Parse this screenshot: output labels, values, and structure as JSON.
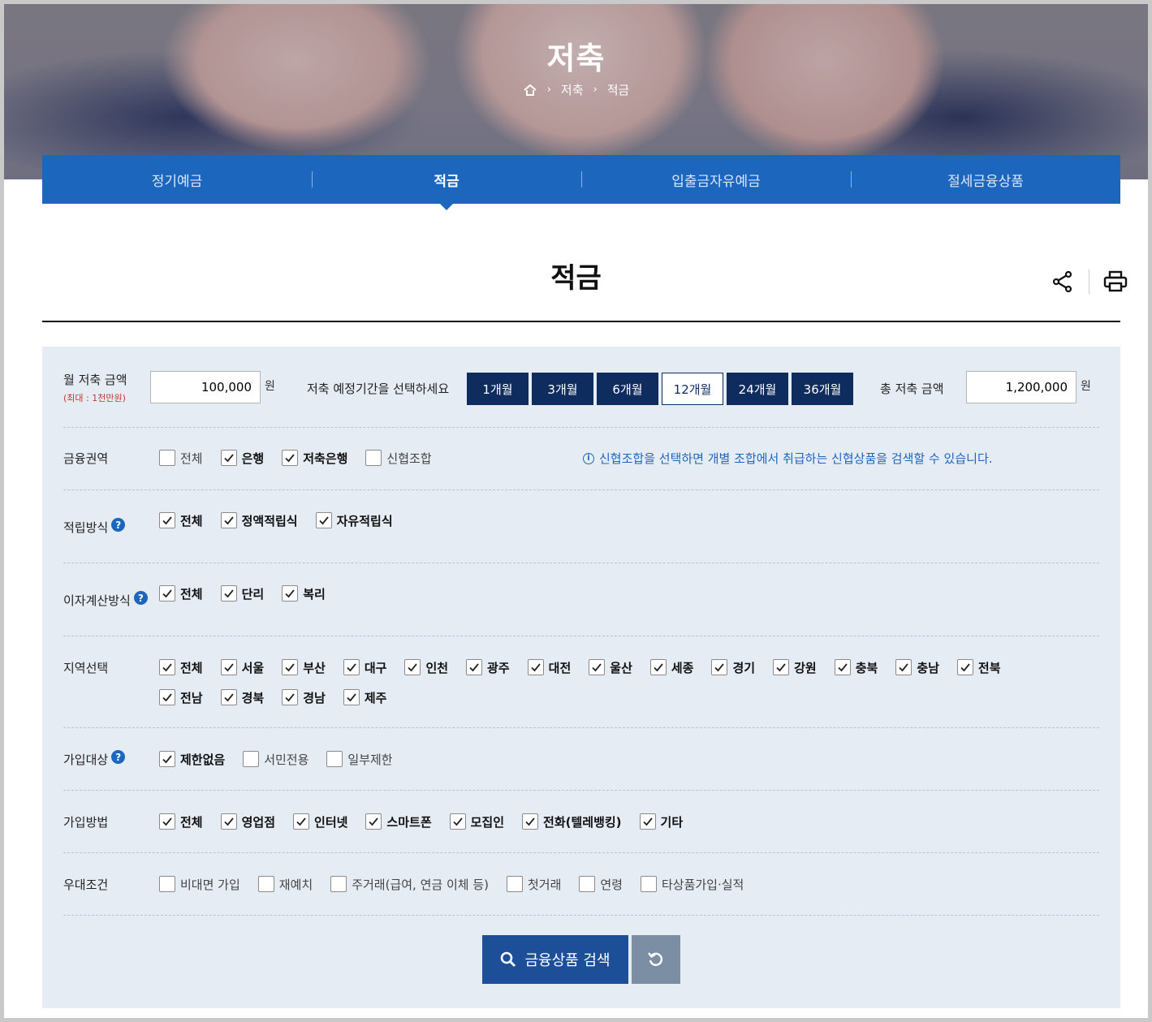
{
  "hero": {
    "title": "저축",
    "breadcrumb": [
      "저축",
      "적금"
    ]
  },
  "tabs": [
    {
      "label": "정기예금",
      "active": false
    },
    {
      "label": "적금",
      "active": true
    },
    {
      "label": "입출금자유예금",
      "active": false
    },
    {
      "label": "절세금융상품",
      "active": false
    }
  ],
  "page": {
    "title": "적금"
  },
  "calc": {
    "monthly_label": "월 저축 금액",
    "monthly_sub": "(최대 : 1천만원)",
    "monthly_value": "100,000",
    "unit": "원",
    "period_label": "저축 예정기간을 선택하세요",
    "periods": [
      "1개월",
      "3개월",
      "6개월",
      "12개월",
      "24개월",
      "36개월"
    ],
    "selected_period": "12개월",
    "total_label": "총 저축 금액",
    "total_value": "1,200,000"
  },
  "filters": {
    "region": {
      "label": "금융권역",
      "options": [
        {
          "label": "전체",
          "checked": false
        },
        {
          "label": "은행",
          "checked": true
        },
        {
          "label": "저축은행",
          "checked": true
        },
        {
          "label": "신협조합",
          "checked": false
        }
      ],
      "note": "신협조합을 선택하면 개별 조합에서 취급하는 신협상품을 검색할 수 있습니다."
    },
    "saving_method": {
      "label": "적립방식",
      "options": [
        {
          "label": "전체",
          "checked": true
        },
        {
          "label": "정액적립식",
          "checked": true
        },
        {
          "label": "자유적립식",
          "checked": true
        }
      ]
    },
    "interest_method": {
      "label": "이자계산방식",
      "options": [
        {
          "label": "전체",
          "checked": true
        },
        {
          "label": "단리",
          "checked": true
        },
        {
          "label": "복리",
          "checked": true
        }
      ]
    },
    "area": {
      "label": "지역선택",
      "options": [
        {
          "label": "전체",
          "checked": true
        },
        {
          "label": "서울",
          "checked": true
        },
        {
          "label": "부산",
          "checked": true
        },
        {
          "label": "대구",
          "checked": true
        },
        {
          "label": "인천",
          "checked": true
        },
        {
          "label": "광주",
          "checked": true
        },
        {
          "label": "대전",
          "checked": true
        },
        {
          "label": "울산",
          "checked": true
        },
        {
          "label": "세종",
          "checked": true
        },
        {
          "label": "경기",
          "checked": true
        },
        {
          "label": "강원",
          "checked": true
        },
        {
          "label": "충북",
          "checked": true
        },
        {
          "label": "충남",
          "checked": true
        },
        {
          "label": "전북",
          "checked": true
        },
        {
          "label": "전남",
          "checked": true
        },
        {
          "label": "경북",
          "checked": true
        },
        {
          "label": "경남",
          "checked": true
        },
        {
          "label": "제주",
          "checked": true
        }
      ]
    },
    "target": {
      "label": "가입대상",
      "options": [
        {
          "label": "제한없음",
          "checked": true
        },
        {
          "label": "서민전용",
          "checked": false
        },
        {
          "label": "일부제한",
          "checked": false
        }
      ]
    },
    "join_method": {
      "label": "가입방법",
      "options": [
        {
          "label": "전체",
          "checked": true
        },
        {
          "label": "영업점",
          "checked": true
        },
        {
          "label": "인터넷",
          "checked": true
        },
        {
          "label": "스마트폰",
          "checked": true
        },
        {
          "label": "모집인",
          "checked": true
        },
        {
          "label": "전화(텔레뱅킹)",
          "checked": true
        },
        {
          "label": "기타",
          "checked": true
        }
      ]
    },
    "benefit": {
      "label": "우대조건",
      "options": [
        {
          "label": "비대면 가입",
          "checked": false
        },
        {
          "label": "재예치",
          "checked": false
        },
        {
          "label": "주거래(급여, 연금 이체 등)",
          "checked": false
        },
        {
          "label": "첫거래",
          "checked": false
        },
        {
          "label": "연령",
          "checked": false
        },
        {
          "label": "타상품가입·실적",
          "checked": false
        }
      ]
    }
  },
  "actions": {
    "search_label": "금융상품 검색"
  },
  "colors": {
    "primary": "#1c66be",
    "dark_navy": "#0f2c5e",
    "panel_bg": "#e6ecf4"
  },
  "icons": [
    "home-icon",
    "share-icon",
    "print-icon",
    "help-icon",
    "info-icon",
    "search-icon",
    "reset-icon"
  ]
}
